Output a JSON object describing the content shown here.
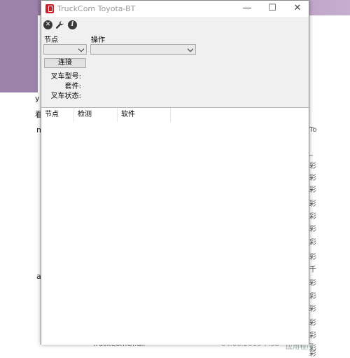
{
  "window": {
    "title": "TruckCom Toyota-BT",
    "minimize": "—",
    "maximize": "☐",
    "close": "✕"
  },
  "toolbar": {
    "icons": [
      "close-circle-icon",
      "wrench-icon",
      "info-icon"
    ],
    "close_glyph": "✕",
    "info_glyph": "i"
  },
  "form": {
    "node_label": "节点",
    "operation_label": "操作",
    "node_value": "",
    "operation_value": "",
    "connect_button": "连接",
    "forklift_model_label": "叉车型号:",
    "kit_label": "套件:",
    "forklift_status_label": "叉车状态:"
  },
  "table": {
    "columns": [
      "节点",
      "检测",
      "软件"
    ]
  },
  "background": {
    "left_fragments": [
      "y",
      "看",
      "m",
      "a"
    ],
    "right_fragments": [
      "To",
      "_",
      "彩",
      "彩",
      "彩",
      "彩",
      "彩",
      "彩",
      "彩",
      "彩",
      "千",
      "彩",
      "彩",
      "彩",
      "彩",
      "彩",
      "彩",
      "彩"
    ],
    "bottom_file": "TruckComOI.dll",
    "bottom_date": "04.03.2019 7:58",
    "bottom_type": "应用程序"
  }
}
